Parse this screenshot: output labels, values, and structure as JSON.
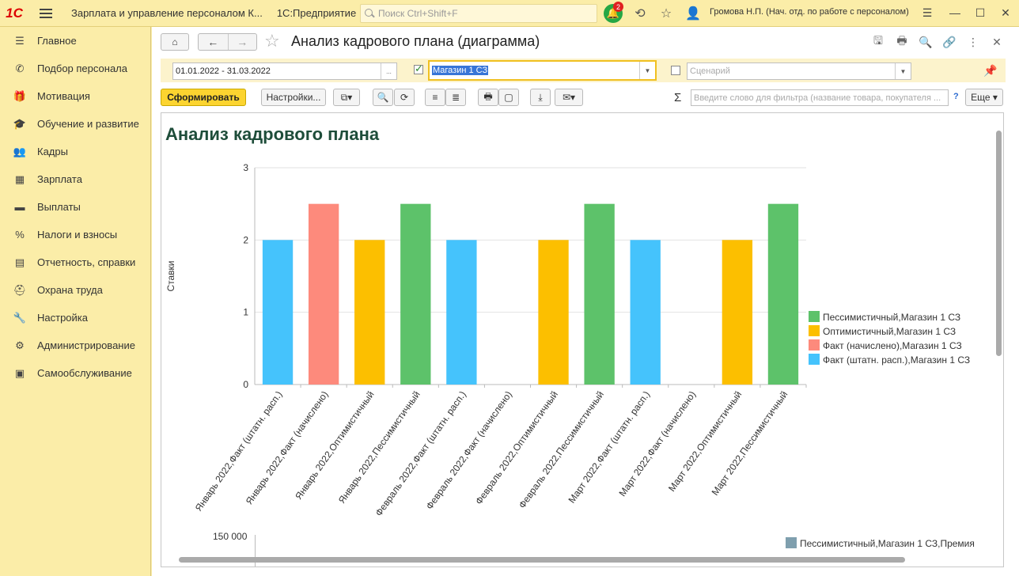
{
  "topbar": {
    "logo": "1С",
    "app_title": "Зарплата и управление персоналом К...",
    "platform": "1С:Предприятие",
    "search_placeholder": "Поиск Ctrl+Shift+F",
    "notifications_count": "2",
    "user": "Громова Н.П. (Нач. отд. по работе с персоналом)"
  },
  "sidebar": {
    "items": [
      {
        "label": "Главное",
        "icon": "menu-icon"
      },
      {
        "label": "Подбор персонала",
        "icon": "phone-icon"
      },
      {
        "label": "Мотивация",
        "icon": "gift-icon"
      },
      {
        "label": "Обучение и развитие",
        "icon": "graduation-icon"
      },
      {
        "label": "Кадры",
        "icon": "people-icon"
      },
      {
        "label": "Зарплата",
        "icon": "calculator-icon"
      },
      {
        "label": "Выплаты",
        "icon": "wallet-icon"
      },
      {
        "label": "Налоги и взносы",
        "icon": "percent-icon"
      },
      {
        "label": "Отчетность, справки",
        "icon": "report-icon"
      },
      {
        "label": "Охрана труда",
        "icon": "shield-icon"
      },
      {
        "label": "Настройка",
        "icon": "wrench-icon"
      },
      {
        "label": "Администрирование",
        "icon": "gear-icon"
      },
      {
        "label": "Самообслуживание",
        "icon": "id-card-icon"
      }
    ]
  },
  "form": {
    "title": "Анализ кадрового плана (диаграмма)",
    "period": "01.01.2022 - 31.03.2022",
    "period_btn": "...",
    "store": "Магазин 1 СЗ",
    "scenario_placeholder": "Сценарий",
    "generate_btn": "Сформировать",
    "settings_btn": "Настройки...",
    "filter_placeholder": "Введите слово для фильтра (название товара, покупателя ...",
    "help": "?",
    "more_btn": "Еще"
  },
  "report": {
    "title": "Анализ кадрового плана",
    "second_axis_tick": "150 000",
    "second_legend": "Пессимистичный,Магазин 1 СЗ,Премия"
  },
  "colors": {
    "pessimistic": "#5dc26a",
    "optimistic": "#fcbf00",
    "fact_accrued": "#fd8a7c",
    "fact_staff": "#45c3fc"
  },
  "chart_data": {
    "type": "bar",
    "ylabel": "Ставки",
    "ylim": [
      0,
      3
    ],
    "yticks": [
      "0",
      "1",
      "2",
      "3"
    ],
    "categories": [
      "Январь 2022,Факт (штатн. расп.)",
      "Январь 2022,Факт (начислено)",
      "Январь 2022,Оптимистичный",
      "Январь 2022,Пессимистичный",
      "Февраль 2022,Факт (штатн. расп.)",
      "Февраль 2022,Факт (начислено)",
      "Февраль 2022,Оптимистичный",
      "Февраль 2022,Пессимистичный",
      "Март 2022,Факт (штатн. расп.)",
      "Март 2022,Факт (начислено)",
      "Март 2022,Оптимистичный",
      "Март 2022,Пессимистичный"
    ],
    "values": [
      2,
      2.5,
      2,
      2.5,
      2,
      0,
      2,
      2.5,
      2,
      0,
      2,
      2.5
    ],
    "bar_series": [
      3,
      2,
      1,
      0,
      3,
      2,
      1,
      0,
      3,
      2,
      1,
      0
    ],
    "series": [
      {
        "name": "Пессимистичный,Магазин 1 СЗ",
        "color": "#5dc26a"
      },
      {
        "name": "Оптимистичный,Магазин 1 СЗ",
        "color": "#fcbf00"
      },
      {
        "name": "Факт (начислено),Магазин 1 СЗ",
        "color": "#fd8a7c"
      },
      {
        "name": "Факт (штатн. расп.),Магазин 1 СЗ",
        "color": "#45c3fc"
      }
    ],
    "legend": "right",
    "grid": true
  }
}
